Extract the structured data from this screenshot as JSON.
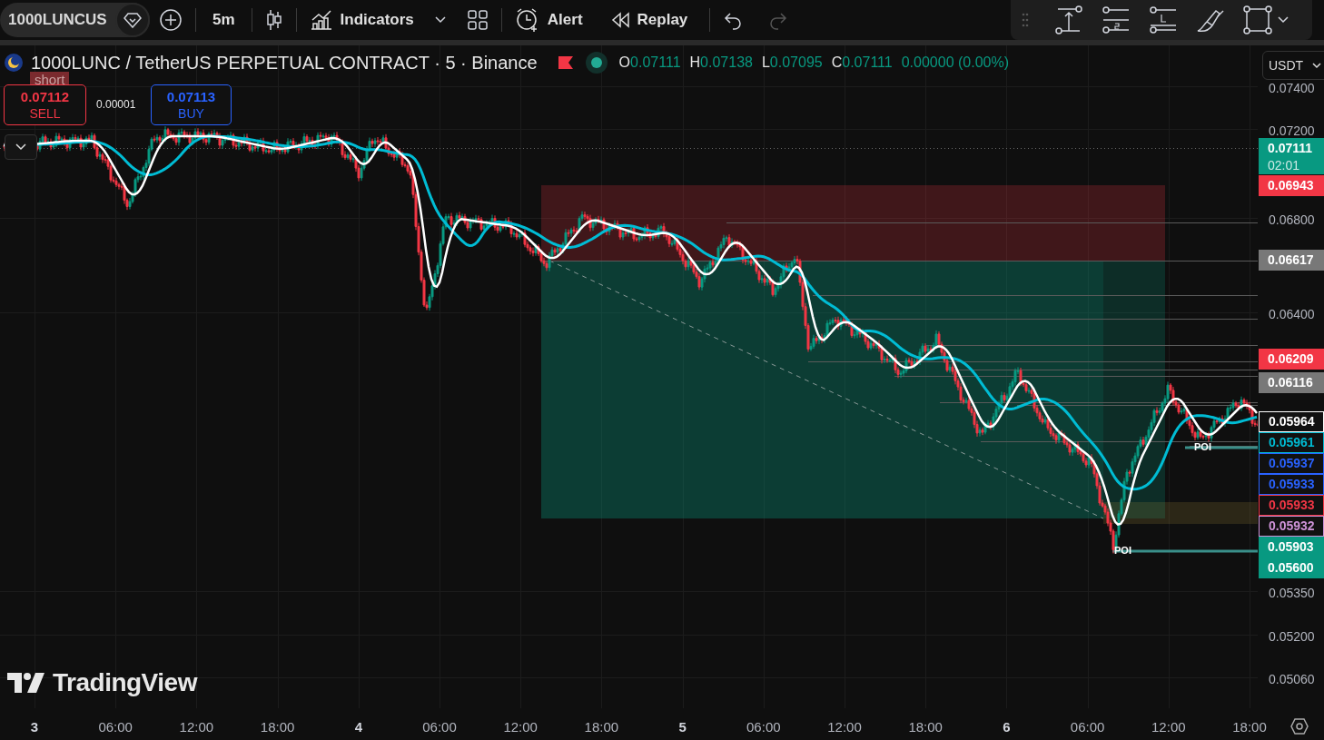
{
  "toolbar": {
    "symbol": "1000LUNCUS",
    "interval": "5m",
    "buttons": [
      {
        "kind": "indicators",
        "label": "Indicators"
      },
      {
        "kind": "alert",
        "label": "Alert"
      },
      {
        "kind": "replay",
        "label": "Replay"
      }
    ],
    "history": [
      {
        "kind": "undo",
        "disabled": false
      },
      {
        "kind": "redo",
        "disabled": true
      }
    ]
  },
  "legend": {
    "title": "1000LUNC / TetherUS PERPETUAL CONTRACT · 5 · Binance",
    "ohlc": [
      {
        "key": "O",
        "value": "0.07111"
      },
      {
        "key": "H",
        "value": "0.07138"
      },
      {
        "key": "L",
        "value": "0.07095"
      },
      {
        "key": "C",
        "value": "0.07111"
      }
    ],
    "change": "0.00000 (0.00%)"
  },
  "trade": {
    "tag": "short",
    "sell_price": "0.07112",
    "sell_label": "SELL",
    "spread": "0.00001",
    "buy_price": "0.07113",
    "buy_label": "BUY"
  },
  "currency": "USDT",
  "price_axis": {
    "ticks": [
      "0.07400",
      "0.07200",
      "0.06800",
      "0.06400",
      "0.05350",
      "0.05200",
      "0.05060"
    ],
    "labels": [
      {
        "text": "0.07111",
        "sub": "02:01",
        "kind": "fill",
        "color": "#089981"
      },
      {
        "text": "0.06943",
        "kind": "fill",
        "color": "#f23645"
      },
      {
        "text": "0.06617",
        "kind": "fill",
        "color": "#787878"
      },
      {
        "text": "0.06209",
        "kind": "fill",
        "color": "#f23645"
      },
      {
        "text": "0.06116",
        "kind": "fill",
        "color": "#787878"
      },
      {
        "text": "0.05964",
        "kind": "outline",
        "color": "#ffffff"
      },
      {
        "text": "0.05961",
        "kind": "outline",
        "color": "#00bcd4"
      },
      {
        "text": "0.05937",
        "kind": "outline",
        "color": "#2962ff"
      },
      {
        "text": "0.05933",
        "kind": "outline",
        "color": "#2962ff"
      },
      {
        "text": "0.05933",
        "kind": "outline",
        "color": "#f23645"
      },
      {
        "text": "0.05932",
        "kind": "outline",
        "color": "#ce93d8"
      },
      {
        "text": "0.05903",
        "kind": "fill",
        "color": "#089981"
      },
      {
        "text": "0.05600",
        "kind": "fill",
        "color": "#089981"
      }
    ]
  },
  "markers": [
    {
      "text": "POI"
    },
    {
      "text": "POI"
    }
  ],
  "logo": "TradingView",
  "time_axis": [
    {
      "label": "3",
      "major": true
    },
    {
      "label": "06:00",
      "major": false
    },
    {
      "label": "12:00",
      "major": false
    },
    {
      "label": "18:00",
      "major": false
    },
    {
      "label": "4",
      "major": true
    },
    {
      "label": "06:00",
      "major": false
    },
    {
      "label": "12:00",
      "major": false
    },
    {
      "label": "18:00",
      "major": false
    },
    {
      "label": "5",
      "major": true
    },
    {
      "label": "06:00",
      "major": false
    },
    {
      "label": "12:00",
      "major": false
    },
    {
      "label": "18:00",
      "major": false
    },
    {
      "label": "6",
      "major": true
    },
    {
      "label": "06:00",
      "major": false
    },
    {
      "label": "12:00",
      "major": false
    },
    {
      "label": "18:00",
      "major": false
    }
  ]
}
